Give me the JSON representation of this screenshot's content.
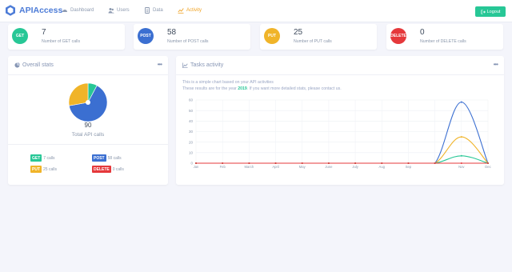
{
  "app": {
    "brand": "APIAccess"
  },
  "nav": {
    "items": [
      {
        "label": "Dashboard",
        "icon": "dashboard-icon"
      },
      {
        "label": "Users",
        "icon": "users-icon"
      },
      {
        "label": "Data",
        "icon": "data-icon"
      },
      {
        "label": "Activity",
        "icon": "activity-icon",
        "active": true
      }
    ],
    "logout_label": "Logout"
  },
  "stats": [
    {
      "method": "GET",
      "value": "7",
      "label": "Number of GET calls",
      "color": "#27c796"
    },
    {
      "method": "POST",
      "value": "58",
      "label": "Number of POST calls",
      "color": "#3b6fd1"
    },
    {
      "method": "PUT",
      "value": "25",
      "label": "Number of PUT calls",
      "color": "#f0b429"
    },
    {
      "method": "DELETE",
      "value": "0",
      "label": "Number of DELETE calls",
      "color": "#e5383b"
    }
  ],
  "overall": {
    "title": "Overall stats",
    "total_value": "90",
    "total_label": "Total API calls",
    "legend": [
      {
        "method": "GET",
        "text": "7 calls"
      },
      {
        "method": "POST",
        "text": "58 calls"
      },
      {
        "method": "PUT",
        "text": "25 calls"
      },
      {
        "method": "DELETE",
        "text": "0 calls"
      }
    ]
  },
  "activity": {
    "title": "Tasks activity",
    "desc_line1": "This is a simple chart based on your API activities",
    "desc_line2_prefix": "These results are for the year",
    "year": "2019",
    "desc_line2_suffix": ". If you want more detailed stats, please contact us."
  },
  "chart_data": [
    {
      "type": "pie",
      "categories": [
        "GET",
        "POST",
        "PUT",
        "DELETE"
      ],
      "values": [
        7,
        58,
        25,
        0
      ],
      "colors": [
        "#27c796",
        "#3b6fd1",
        "#f0b429",
        "#e5383b"
      ]
    },
    {
      "type": "line",
      "categories": [
        "Jan",
        "Feb",
        "March",
        "April",
        "May",
        "June",
        "July",
        "Aug",
        "Sep",
        "Nov",
        "Dec"
      ],
      "ylim": [
        0,
        60
      ],
      "yticks": [
        0,
        10,
        20,
        30,
        40,
        50,
        60
      ],
      "grid": true,
      "series": [
        {
          "name": "POST",
          "color": "#3b6fd1",
          "values": [
            0,
            0,
            0,
            0,
            0,
            0,
            0,
            0,
            0,
            0,
            58,
            0
          ]
        },
        {
          "name": "PUT",
          "color": "#f0b429",
          "values": [
            0,
            0,
            0,
            0,
            0,
            0,
            0,
            0,
            0,
            0,
            25,
            0
          ]
        },
        {
          "name": "GET",
          "color": "#27c796",
          "values": [
            0,
            0,
            0,
            0,
            0,
            0,
            0,
            0,
            0,
            0,
            7,
            0
          ]
        },
        {
          "name": "DELETE",
          "color": "#e5383b",
          "values": [
            0,
            0,
            0,
            0,
            0,
            0,
            0,
            0,
            0,
            0,
            0,
            0
          ]
        }
      ]
    }
  ]
}
